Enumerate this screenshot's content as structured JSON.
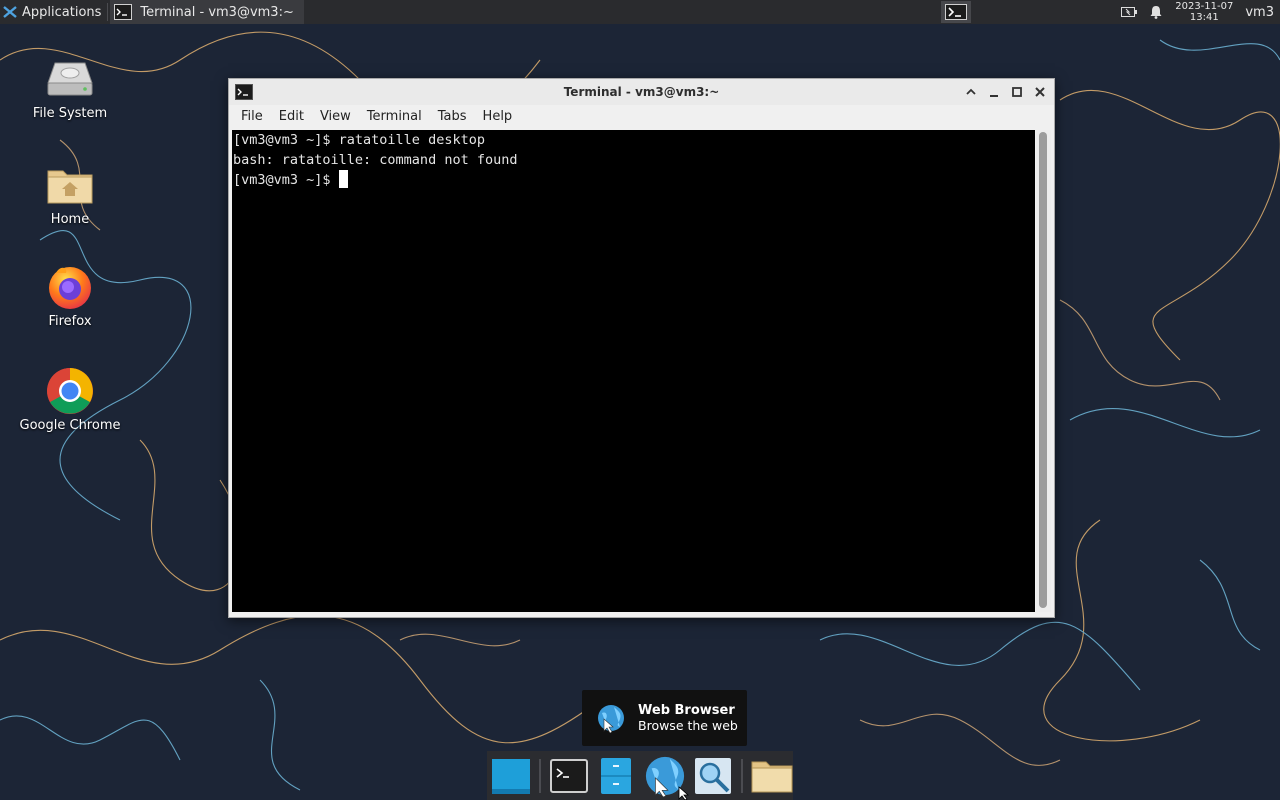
{
  "top_panel": {
    "apps_label": "Applications",
    "apps_icon": "xfce-logo-icon",
    "task_title": "Terminal - vm3@vm3:~",
    "clock_date": "2023-11-07",
    "clock_time": "13:41",
    "user": "vm3"
  },
  "desktop_icons": [
    {
      "label": "File System",
      "icon": "drive-icon"
    },
    {
      "label": "Home",
      "icon": "home-folder-icon"
    },
    {
      "label": "Firefox",
      "icon": "firefox-icon"
    },
    {
      "label": "Google Chrome",
      "icon": "chrome-icon"
    }
  ],
  "window": {
    "title": "Terminal - vm3@vm3:~",
    "menu": [
      "File",
      "Edit",
      "View",
      "Terminal",
      "Tabs",
      "Help"
    ],
    "lines": [
      "[vm3@vm3 ~]$ ratatoille desktop",
      "bash: ratatoille: command not found",
      "[vm3@vm3 ~]$ "
    ]
  },
  "tooltip": {
    "title": "Web Browser",
    "subtitle": "Browse the web"
  },
  "dock": {
    "items": [
      "show-desktop-icon",
      "terminal-icon",
      "file-manager-icon",
      "web-browser-icon",
      "app-finder-icon",
      "folder-icon"
    ]
  },
  "colors": {
    "wallpaper_bg": "#1b2434",
    "panel_bg": "#2a2b2e",
    "terminal_bg": "#000000",
    "terminal_fg": "#e5e5e5"
  }
}
